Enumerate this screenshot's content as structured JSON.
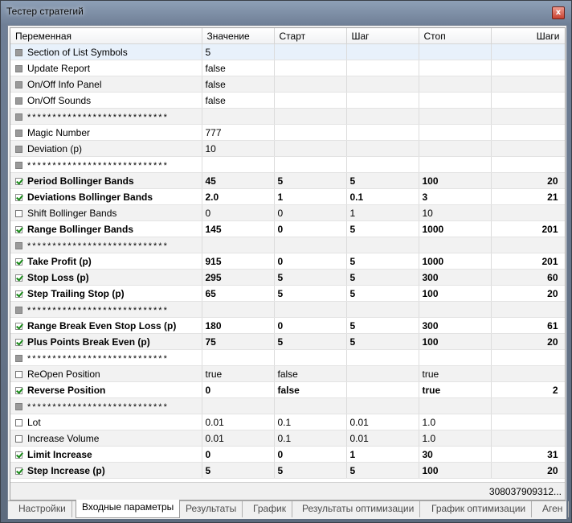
{
  "window": {
    "title": "Тестер стратегий",
    "close_glyph": "x"
  },
  "grid": {
    "headers": [
      "Переменная",
      "Значение",
      "Старт",
      "Шаг",
      "Стоп",
      "Шаги"
    ],
    "rows": [
      {
        "name": "Section of List Symbols",
        "value": "5",
        "start": "",
        "step": "",
        "stop": "",
        "steps": "",
        "checked": "off",
        "bold": false
      },
      {
        "name": "Update Report",
        "value": "false",
        "start": "",
        "step": "",
        "stop": "",
        "steps": "",
        "checked": "off",
        "bold": false
      },
      {
        "name": "On/Off Info Panel",
        "value": "false",
        "start": "",
        "step": "",
        "stop": "",
        "steps": "",
        "checked": "off",
        "bold": false
      },
      {
        "name": "On/Off Sounds",
        "value": "false",
        "start": "",
        "step": "",
        "stop": "",
        "steps": "",
        "checked": "off",
        "bold": false
      },
      {
        "name": "****************************",
        "value": "",
        "start": "",
        "step": "",
        "stop": "",
        "steps": "",
        "checked": "off",
        "bold": false
      },
      {
        "name": "Magic Number",
        "value": "777",
        "start": "",
        "step": "",
        "stop": "",
        "steps": "",
        "checked": "off",
        "bold": false
      },
      {
        "name": "Deviation (p)",
        "value": "10",
        "start": "",
        "step": "",
        "stop": "",
        "steps": "",
        "checked": "off",
        "bold": false
      },
      {
        "name": "****************************",
        "value": "",
        "start": "",
        "step": "",
        "stop": "",
        "steps": "",
        "checked": "off",
        "bold": false
      },
      {
        "name": "Period Bollinger Bands",
        "value": "45",
        "start": "5",
        "step": "5",
        "stop": "100",
        "steps": "20",
        "checked": "on",
        "bold": true
      },
      {
        "name": "Deviations Bollinger Bands",
        "value": "2.0",
        "start": "1",
        "step": "0.1",
        "stop": "3",
        "steps": "21",
        "checked": "on",
        "bold": true
      },
      {
        "name": "Shift Bollinger Bands",
        "value": "0",
        "start": "0",
        "step": "1",
        "stop": "10",
        "steps": "",
        "checked": "off-empty",
        "bold": false
      },
      {
        "name": "Range Bollinger Bands",
        "value": "145",
        "start": "0",
        "step": "5",
        "stop": "1000",
        "steps": "201",
        "checked": "on",
        "bold": true
      },
      {
        "name": "****************************",
        "value": "",
        "start": "",
        "step": "",
        "stop": "",
        "steps": "",
        "checked": "off",
        "bold": false
      },
      {
        "name": "Take Profit (p)",
        "value": "915",
        "start": "0",
        "step": "5",
        "stop": "1000",
        "steps": "201",
        "checked": "on",
        "bold": true
      },
      {
        "name": "Stop Loss (p)",
        "value": "295",
        "start": "5",
        "step": "5",
        "stop": "300",
        "steps": "60",
        "checked": "on",
        "bold": true
      },
      {
        "name": "Step Trailing Stop (p)",
        "value": "65",
        "start": "5",
        "step": "5",
        "stop": "100",
        "steps": "20",
        "checked": "on",
        "bold": true
      },
      {
        "name": "****************************",
        "value": "",
        "start": "",
        "step": "",
        "stop": "",
        "steps": "",
        "checked": "off",
        "bold": false
      },
      {
        "name": "Range Break Even Stop Loss (p)",
        "value": "180",
        "start": "0",
        "step": "5",
        "stop": "300",
        "steps": "61",
        "checked": "on",
        "bold": true
      },
      {
        "name": "Plus Points Break Even (p)",
        "value": "75",
        "start": "5",
        "step": "5",
        "stop": "100",
        "steps": "20",
        "checked": "on",
        "bold": true
      },
      {
        "name": "****************************",
        "value": "",
        "start": "",
        "step": "",
        "stop": "",
        "steps": "",
        "checked": "off",
        "bold": false
      },
      {
        "name": "ReOpen Position",
        "value": "true",
        "start": "false",
        "step": "",
        "stop": "true",
        "steps": "",
        "checked": "off-empty",
        "bold": false
      },
      {
        "name": "Reverse Position",
        "value": "0",
        "start": "false",
        "step": "",
        "stop": "true",
        "steps": "2",
        "checked": "on",
        "bold": true
      },
      {
        "name": "****************************",
        "value": "",
        "start": "",
        "step": "",
        "stop": "",
        "steps": "",
        "checked": "off",
        "bold": false
      },
      {
        "name": "Lot",
        "value": "0.01",
        "start": "0.1",
        "step": "0.01",
        "stop": "1.0",
        "steps": "",
        "checked": "off-empty",
        "bold": false
      },
      {
        "name": "Increase Volume",
        "value": "0.01",
        "start": "0.1",
        "step": "0.01",
        "stop": "1.0",
        "steps": "",
        "checked": "off-empty",
        "bold": false
      },
      {
        "name": "Limit Increase",
        "value": "0",
        "start": "0",
        "step": "1",
        "stop": "30",
        "steps": "31",
        "checked": "on",
        "bold": true
      },
      {
        "name": "Step Increase (p)",
        "value": "5",
        "start": "5",
        "step": "5",
        "stop": "100",
        "steps": "20",
        "checked": "on",
        "bold": true
      }
    ],
    "total_steps": "308037909312..."
  },
  "tabs": [
    {
      "label": "Настройки",
      "active": false
    },
    {
      "label": "Входные параметры",
      "active": true
    },
    {
      "label": "Результаты",
      "active": false
    },
    {
      "label": "График",
      "active": false
    },
    {
      "label": "Результаты оптимизации",
      "active": false
    },
    {
      "label": "График оптимизации",
      "active": false
    },
    {
      "label": "Аген",
      "active": false
    }
  ]
}
